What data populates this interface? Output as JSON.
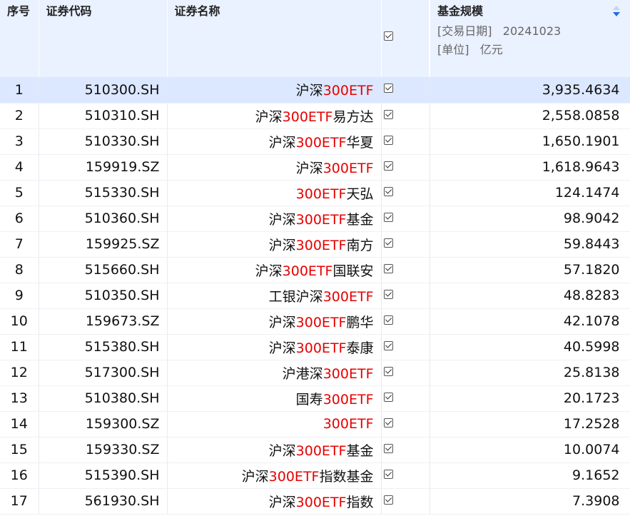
{
  "header": {
    "seq": "序号",
    "code": "证券代码",
    "name": "证券名称",
    "scale_title": "基金规模",
    "date_label": "[交易日期]",
    "date_value": "20241023",
    "unit_label": "[单位]",
    "unit_value": "亿元"
  },
  "colors": {
    "header_bg": "#eaf1ff",
    "selected_row_bg": "#dce8ff",
    "highlight_text": "#e60000",
    "sort_active": "#1a6ee8"
  },
  "rows": [
    {
      "seq": "1",
      "code": "510300.SH",
      "name_pre": "沪深",
      "name_hl": "300ETF",
      "name_post": "",
      "checked": true,
      "scale": "3,935.4634"
    },
    {
      "seq": "2",
      "code": "510310.SH",
      "name_pre": "沪深",
      "name_hl": "300ETF",
      "name_post": "易方达",
      "checked": true,
      "scale": "2,558.0858"
    },
    {
      "seq": "3",
      "code": "510330.SH",
      "name_pre": "沪深",
      "name_hl": "300ETF",
      "name_post": "华夏",
      "checked": true,
      "scale": "1,650.1901"
    },
    {
      "seq": "4",
      "code": "159919.SZ",
      "name_pre": "沪深",
      "name_hl": "300ETF",
      "name_post": "",
      "checked": true,
      "scale": "1,618.9643"
    },
    {
      "seq": "5",
      "code": "515330.SH",
      "name_pre": "",
      "name_hl": "300ETF",
      "name_post": "天弘",
      "checked": true,
      "scale": "124.1474"
    },
    {
      "seq": "6",
      "code": "510360.SH",
      "name_pre": "沪深",
      "name_hl": "300ETF",
      "name_post": "基金",
      "checked": true,
      "scale": "98.9042"
    },
    {
      "seq": "7",
      "code": "159925.SZ",
      "name_pre": "沪深",
      "name_hl": "300ETF",
      "name_post": "南方",
      "checked": true,
      "scale": "59.8443"
    },
    {
      "seq": "8",
      "code": "515660.SH",
      "name_pre": "沪深",
      "name_hl": "300ETF",
      "name_post": "国联安",
      "checked": true,
      "scale": "57.1820"
    },
    {
      "seq": "9",
      "code": "510350.SH",
      "name_pre": "工银沪深",
      "name_hl": "300ETF",
      "name_post": "",
      "checked": true,
      "scale": "48.8283"
    },
    {
      "seq": "10",
      "code": "159673.SZ",
      "name_pre": "沪深",
      "name_hl": "300ETF",
      "name_post": "鹏华",
      "checked": true,
      "scale": "42.1078"
    },
    {
      "seq": "11",
      "code": "515380.SH",
      "name_pre": "沪深",
      "name_hl": "300ETF",
      "name_post": "泰康",
      "checked": true,
      "scale": "40.5998"
    },
    {
      "seq": "12",
      "code": "517300.SH",
      "name_pre": "沪港深",
      "name_hl": "300ETF",
      "name_post": "",
      "checked": true,
      "scale": "25.8138"
    },
    {
      "seq": "13",
      "code": "510380.SH",
      "name_pre": "国寿",
      "name_hl": "300ETF",
      "name_post": "",
      "checked": true,
      "scale": "20.1723"
    },
    {
      "seq": "14",
      "code": "159300.SZ",
      "name_pre": "",
      "name_hl": "300ETF",
      "name_post": "",
      "checked": true,
      "scale": "17.2528"
    },
    {
      "seq": "15",
      "code": "159330.SZ",
      "name_pre": "沪深",
      "name_hl": "300ETF",
      "name_post": "基金",
      "checked": true,
      "scale": "10.0074"
    },
    {
      "seq": "16",
      "code": "515390.SH",
      "name_pre": "沪深",
      "name_hl": "300ETF",
      "name_post": "指数基金",
      "checked": true,
      "scale": "9.1652"
    },
    {
      "seq": "17",
      "code": "561930.SH",
      "name_pre": "沪深",
      "name_hl": "300ETF",
      "name_post": "指数",
      "checked": true,
      "scale": "7.3908"
    }
  ]
}
